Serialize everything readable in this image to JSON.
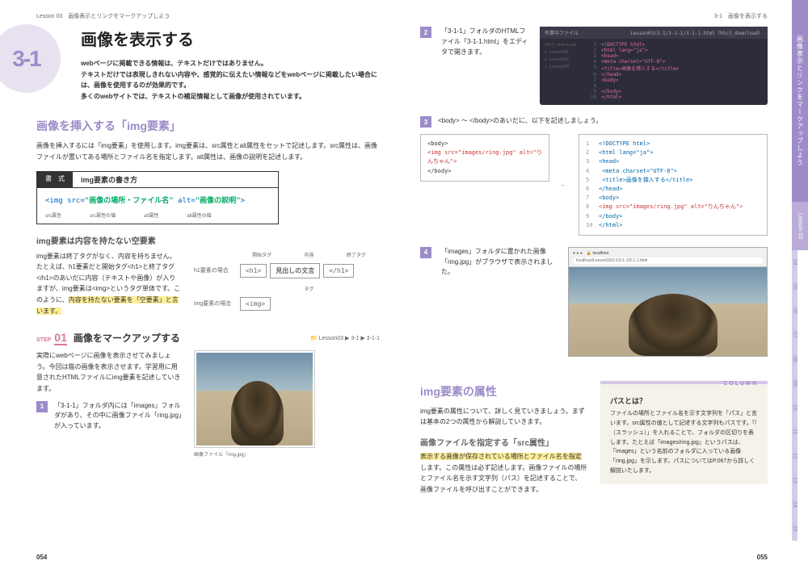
{
  "header": {
    "left_chapter": "Lesson 03　画像表示とリンクをマークアップしよう",
    "right_section": "3-1　画像を表示する"
  },
  "section": {
    "number": "3-1",
    "title": "画像を表示する",
    "lead": "webページに掲載できる情報は、テキストだけではありません。\nテキストだけでは表現しきれない内容や、感覚的に伝えたい情報などをwebページに掲載したい場合には、画像を使用するのが効果的です。\n多くのwebサイトでは、テキストの補足情報として画像が使用されています。"
  },
  "h2_1": "画像を挿入する「img要素」",
  "body1": "画像を挿入するには「img要素」を使用します。img要素は、src属性とalt属性をセットで記述します。src属性は、画像ファイルが置いてある場所とファイル名を指定します。alt属性は、画像の説明を記述します。",
  "syntax": {
    "label": "書　式",
    "title": "img要素の書き方",
    "code_tag": "<img ",
    "code_src": "src=",
    "code_src_val": "\"画像の場所・ファイル名\"",
    "code_alt": " alt=",
    "code_alt_val": "\"画像の説明\"",
    "code_end": ">",
    "annot": {
      "a1": "src属性",
      "a2": "src属性の値",
      "a3": "alt属性",
      "a4": "alt属性の値"
    }
  },
  "h3_1": "img要素は内容を持たない空要素",
  "body2": "img要素は終了タグがなく、内容を持ちません。たとえば、h1要素だと開始タグ<h1>と終了タグ</h1>のあいだに内容（テキストや画像）が入りますが、img要素は<img>というタグ単体です。このように、",
  "body2_hl": "内容を持たない要素を「空要素」と言います。",
  "tagdiag": {
    "h1": "h1要素の場合",
    "img": "img要素の場合",
    "open": "開始タグ",
    "content": "内容",
    "close": "終了タグ",
    "h1_open": "<h1>",
    "h1_mid": "見出しの文言",
    "h1_close": "</h1>",
    "tag": "タグ",
    "img_tag": "<img>"
  },
  "step": {
    "label": "STEP",
    "num": "01",
    "title": "画像をマークアップする",
    "crumb": "Lesson03 ▶ 3-1 ▶ 3-1-1"
  },
  "step_body": "実際にwebページに画像を表示させてみましょう。今回は猫の画像を表示させます。学習用に用意されたHTMLファイルにimg要素を記述していきます。",
  "step1": {
    "n": "1",
    "txt": "「3-1-1」フォルダ内には「images」フォルダがあり、その中に画像ファイル「ring.jpg」が入っています。"
  },
  "cat_caption": "画像ファイル「ring.jpg」",
  "pagenum": {
    "l": "054",
    "r": "055"
  },
  "right": {
    "step2": {
      "n": "2",
      "txt": "「3-1-1」フォルダのHTMLファイル「3-1-1.html」をエディタで開きます。"
    },
    "editor": {
      "topbar_l": "作業中ファイル",
      "topbar_r": "Lesson03/3-1/3-1-1/3-1-1.html（h5c3_download）",
      "side": [
        "h5c3_download",
        "Lesson01",
        "Lesson02",
        "Lesson03"
      ],
      "lines": [
        {
          "n": "1",
          "c": "<!DOCTYPE html>"
        },
        {
          "n": "2",
          "c": "<html lang=\"ja\">"
        },
        {
          "n": "3",
          "c": "<head>"
        },
        {
          "n": "4",
          "c": "    <meta charset=\"UTF-8\">"
        },
        {
          "n": "5",
          "c": "    <title>画像を挿入する</title>"
        },
        {
          "n": "6",
          "c": "</head>"
        },
        {
          "n": "7",
          "c": "<body>"
        },
        {
          "n": "8",
          "c": ""
        },
        {
          "n": "9",
          "c": "</body>"
        },
        {
          "n": "10",
          "c": "</html>"
        }
      ]
    },
    "step3": {
      "n": "3",
      "txt": "<body> 〜 </body>のあいだに、以下を記述しましょう。"
    },
    "snippet": {
      "l1": "<body>",
      "l2": "<img src=\"images/ring.jpg\" alt=\"りんちゃん\">",
      "l3": "</body>"
    },
    "code_full": [
      {
        "n": "1",
        "c": "<!DOCTYPE html>"
      },
      {
        "n": "2",
        "c": "<html lang=\"ja\">"
      },
      {
        "n": "3",
        "c": "<head>"
      },
      {
        "n": "4",
        "c": "    <meta charset=\"UTF-8\">"
      },
      {
        "n": "5",
        "c": "    <title>画像を挿入する</title>"
      },
      {
        "n": "6",
        "c": "</head>"
      },
      {
        "n": "7",
        "c": "<body>"
      },
      {
        "n": "8",
        "c": "<img src=\"images/ring.jpg\" alt=\"りんちゃん\">"
      },
      {
        "n": "9",
        "c": "</body>"
      },
      {
        "n": "10",
        "c": "</html>"
      }
    ],
    "step4": {
      "n": "4",
      "txt": "「images」フォルダに置かれた画像「ring.jpg」がブラウザで表示されました。"
    },
    "h2_2": "img要素の属性",
    "body3": "img要素の属性について、詳しく見ていきましょう。まずは基本の2つの属性から解説していきます。",
    "h3_2": "画像ファイルを指定する「src属性」",
    "body4a": "表示する画像が保存されている場所とファイル名を指定",
    "body4b": "します。この属性は必ず記述します。画像ファイルの場所とファイル名を示す文字列（パス）を記述することで、画像ファイルを呼び出すことができます。",
    "column": {
      "badge": "COLUMN",
      "title": "パスとは？",
      "body": "ファイルの場所とファイル名を示す文字列を「パス」と言います。src属性の値として記述する文字列もパスです。「/（スラッシュ）」を入れることで、フォルダの区切りを表します。たとえば「images/ring.jpg」というパスは、「images」という名前のフォルダに入っている画像「ring.jpg」を示します。パスについてはP.067から詳しく解説いたします。"
    }
  },
  "sidetab": {
    "title": "画像表示とリンクをマークアップしよう",
    "lesson": "Lesson 03",
    "nums": [
      "04",
      "05",
      "06",
      "07",
      "08",
      "09",
      "10",
      "11",
      "12",
      "13",
      "14",
      "15"
    ]
  }
}
